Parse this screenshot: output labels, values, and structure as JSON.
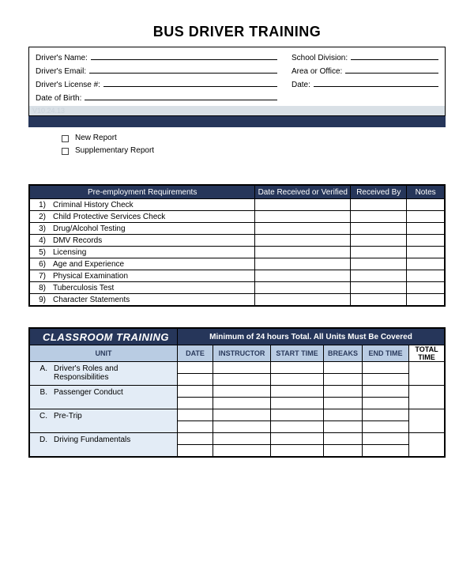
{
  "title": "BUS DRIVER TRAINING",
  "info": {
    "drivers_name": "Driver's Name:",
    "drivers_email": "Driver's Email:",
    "drivers_license": "Driver's License #:",
    "date_of_birth": "Date of Birth:",
    "school_division": "School Division:",
    "area_or_office": "Area or Office:",
    "date": "Date:"
  },
  "version_text": "V10.24.13",
  "checkboxes": {
    "new_report": "New Report",
    "supplementary_report": "Supplementary Report"
  },
  "pre_table": {
    "headers": {
      "requirements": "Pre-employment Requirements",
      "date_received": "Date Received or Verified",
      "received_by": "Received By",
      "notes": "Notes"
    },
    "rows": [
      {
        "num": "1)",
        "label": "Criminal History Check"
      },
      {
        "num": "2)",
        "label": "Child Protective Services Check"
      },
      {
        "num": "3)",
        "label": "Drug/Alcohol Testing"
      },
      {
        "num": "4)",
        "label": "DMV Records"
      },
      {
        "num": "5)",
        "label": "Licensing"
      },
      {
        "num": "6)",
        "label": "Age and Experience"
      },
      {
        "num": "7)",
        "label": "Physical Examination"
      },
      {
        "num": "8)",
        "label": "Tuberculosis Test"
      },
      {
        "num": "9)",
        "label": "Character Statements"
      }
    ]
  },
  "class_table": {
    "title_left": "CLASSROOM TRAINING",
    "title_right": "Minimum of 24 hours Total.  All Units Must Be Covered",
    "headers": {
      "unit": "UNIT",
      "date": "DATE",
      "instructor": "INSTRUCTOR",
      "start_time": "START TIME",
      "breaks": "BREAKS",
      "end_time": "END TIME",
      "total_time": "TOTAL TIME"
    },
    "units": [
      {
        "letter": "A.",
        "name": "Driver's Roles and Responsibilities"
      },
      {
        "letter": "B.",
        "name": "Passenger Conduct"
      },
      {
        "letter": "C.",
        "name": "Pre-Trip"
      },
      {
        "letter": "D.",
        "name": "Driving Fundamentals"
      }
    ]
  }
}
